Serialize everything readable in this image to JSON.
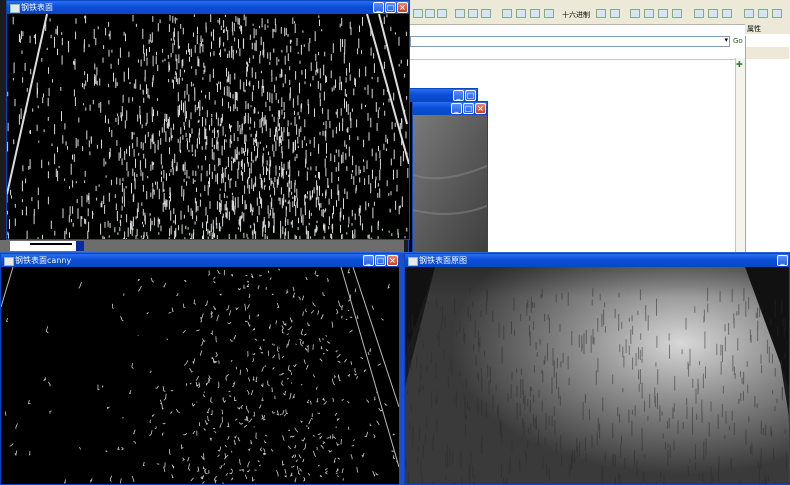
{
  "windows": {
    "gradient": {
      "title": "钢铁表面"
    },
    "canny": {
      "title": "钢铁表面canny"
    },
    "original": {
      "title": "钢铁表面原图"
    },
    "back1": {
      "title": ""
    },
    "back2": {
      "title": ""
    }
  },
  "ide": {
    "toolbar_label": "十六进制",
    "combo_go": "Go",
    "properties_title": "属性"
  },
  "controls": {
    "minimize": "_",
    "maximize": "□",
    "close": "×"
  },
  "colors": {
    "titlebar": "#0a46c4",
    "close": "#c6401f",
    "ide_chrome": "#ece9d8"
  }
}
